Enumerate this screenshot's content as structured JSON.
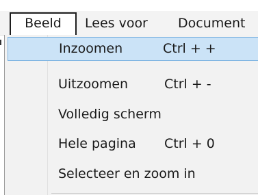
{
  "menubar": {
    "items": [
      {
        "label": "Beeld"
      },
      {
        "label": "Lees voor"
      },
      {
        "label": "Document"
      }
    ]
  },
  "dropdown": {
    "items": [
      {
        "label": "Inzoomen",
        "shortcut": "Ctrl + +",
        "highlighted": true
      },
      {
        "label": "Uitzoomen",
        "shortcut": "Ctrl + -"
      },
      {
        "label": "Volledig scherm",
        "shortcut": ""
      },
      {
        "label": "Hele pagina",
        "shortcut": "Ctrl + 0"
      },
      {
        "label": "Selecteer en zoom in",
        "shortcut": ""
      }
    ]
  },
  "colors": {
    "highlight_bg": "#cbe3f7",
    "highlight_border": "#7db3e1",
    "menu_bg": "#f2f2f2"
  }
}
